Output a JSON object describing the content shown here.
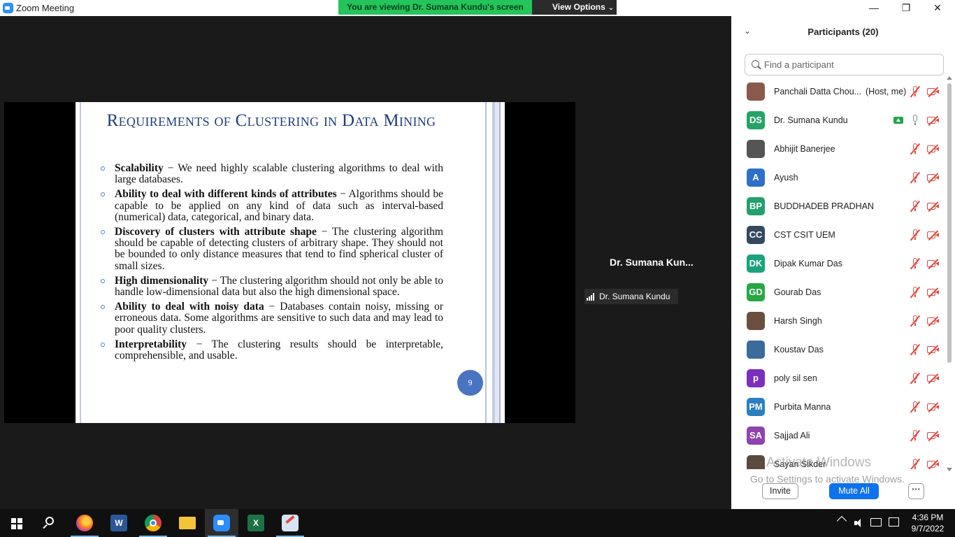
{
  "window": {
    "title": "Zoom Meeting",
    "banner": "You are viewing Dr. Sumana Kundu's screen",
    "view_options": "View Options",
    "controls": {
      "minimize": "—",
      "maximize": "❐",
      "close": "✕"
    }
  },
  "slide": {
    "title": "Requirements of Clustering in Data Mining",
    "page": "9",
    "bullets": [
      {
        "head": "Scalability",
        "text": " − We need highly scalable clustering algorithms to deal with large databases."
      },
      {
        "head": "Ability to deal with different kinds of attributes",
        "text": " − Algorithms should be capable to be applied on any kind of data such as interval-based (numerical) data, categorical, and binary data."
      },
      {
        "head": "Discovery of clusters with attribute shape",
        "text": " − The clustering algorithm should be capable of detecting clusters of arbitrary shape. They should not be bounded to only distance measures that tend to find spherical cluster of small sizes."
      },
      {
        "head": "High dimensionality",
        "text": " − The clustering algorithm should not only be able to handle low-dimensional data but also the high dimensional space."
      },
      {
        "head": "Ability to deal with noisy data",
        "text": " − Databases contain noisy, missing or erroneous data. Some algorithms are sensitive to such data and may lead to poor quality clusters."
      },
      {
        "head": "Interpretability",
        "text": " − The clustering results should be interpretable, comprehensible, and usable."
      }
    ]
  },
  "speaker": {
    "name_truncated": "Dr. Sumana Kun...",
    "label": "Dr. Sumana Kundu"
  },
  "participants": {
    "title": "Participants (20)",
    "search_placeholder": "Find a participant",
    "list": [
      {
        "name": "Panchali Datta Chou...",
        "tag": "(Host, me)",
        "initials": "",
        "color": "#8a5a4a",
        "mic": "muted",
        "photo": true
      },
      {
        "name": "Dr. Sumana Kundu",
        "tag": "",
        "initials": "DS",
        "color": "#23a466",
        "mic": "on",
        "sharing": true
      },
      {
        "name": "Abhijit Banerjee",
        "tag": "",
        "initials": "",
        "color": "#555555",
        "mic": "muted",
        "photo": true
      },
      {
        "name": "Ayush",
        "tag": "",
        "initials": "A",
        "color": "#2e6fc7",
        "mic": "muted"
      },
      {
        "name": "BUDDHADEB PRADHAN",
        "tag": "",
        "initials": "BP",
        "color": "#22a06b",
        "mic": "muted"
      },
      {
        "name": "CST CSIT UEM",
        "tag": "",
        "initials": "CC",
        "color": "#34495e",
        "mic": "muted"
      },
      {
        "name": "Dipak Kumar Das",
        "tag": "",
        "initials": "DK",
        "color": "#1aa37a",
        "mic": "muted"
      },
      {
        "name": "Gourab Das",
        "tag": "",
        "initials": "GD",
        "color": "#28a745",
        "mic": "muted"
      },
      {
        "name": "Harsh Singh",
        "tag": "",
        "initials": "",
        "color": "#6b5040",
        "mic": "muted",
        "photo": true
      },
      {
        "name": "Koustav Das",
        "tag": "",
        "initials": "",
        "color": "#3a6b9a",
        "mic": "muted",
        "photo": true
      },
      {
        "name": "poly sil sen",
        "tag": "",
        "initials": "p",
        "color": "#7b2fbe",
        "mic": "muted"
      },
      {
        "name": "Purbita Manna",
        "tag": "",
        "initials": "PM",
        "color": "#2a7fc0",
        "mic": "muted"
      },
      {
        "name": "Sajjad Ali",
        "tag": "",
        "initials": "SA",
        "color": "#8e44ad",
        "mic": "muted"
      },
      {
        "name": "Sayan Sikder",
        "tag": "",
        "initials": "",
        "color": "#5a4a40",
        "mic": "muted",
        "photo": true
      }
    ],
    "invite": "Invite",
    "mute_all": "Mute All",
    "more": "···"
  },
  "watermark": {
    "line1": "Activate Windows",
    "line2": "Go to Settings to activate Windows."
  },
  "taskbar": {
    "apps": [
      "start-icon",
      "search-icon",
      "firefox-icon",
      "word-icon",
      "chrome-icon",
      "file-explorer-icon",
      "zoom-icon",
      "excel-icon",
      "paint-icon"
    ],
    "active": "zoom-icon",
    "time": "4:36 PM",
    "date": "9/7/2022"
  }
}
